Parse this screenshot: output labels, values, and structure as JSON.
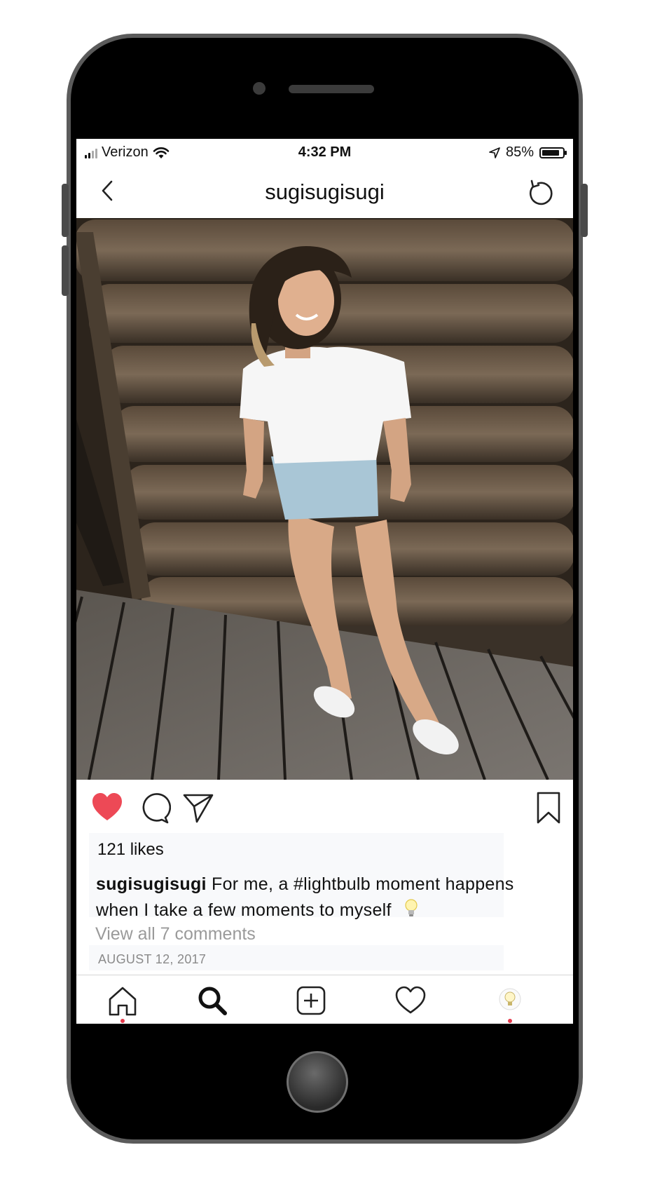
{
  "status_bar": {
    "carrier": "Verizon",
    "time": "4:32 PM",
    "battery_percent": "85%",
    "battery_level": 0.85,
    "icons": [
      "signal-bars-icon",
      "wifi-icon",
      "location-arrow-icon",
      "battery-icon"
    ]
  },
  "header": {
    "title": "sugisugisugi",
    "back_icon": "chevron-left-icon",
    "refresh_icon": "refresh-icon"
  },
  "post": {
    "photo_alt": "post-photo",
    "liked": true,
    "likes": "121 likes",
    "caption_user": "sugisugisugi",
    "caption_text": "For me, a #lightbulb moment happens when I take a few moments to myself",
    "caption_emoji": "lightbulb-emoji",
    "view_comments": "View all 7 comments",
    "date": "AUGUST 12, 2017",
    "actions": [
      "heart-icon",
      "comment-icon",
      "share-icon",
      "bookmark-icon"
    ]
  },
  "tab_bar": {
    "tabs": [
      "home-icon",
      "search-icon",
      "add-post-icon",
      "activity-heart-icon",
      "profile-avatar-icon"
    ],
    "active": "search-icon"
  },
  "colors": {
    "like_red": "#ed4956",
    "notification_dot": "#e5394b",
    "phone_frame": "#000000"
  }
}
